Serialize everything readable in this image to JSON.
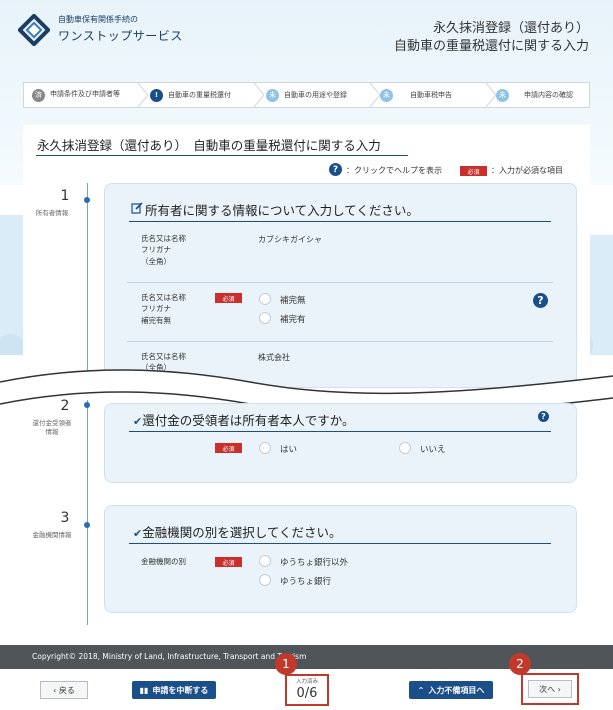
{
  "header": {
    "logo_line1": "自動車保有関係手続の",
    "logo_line2": "ワンストップサービス",
    "title_line1": "永久抹消登録（還付あり）",
    "title_line2": "自動車の重量税還付に関する入力"
  },
  "steps": [
    {
      "label": "申請条件及び申請者等",
      "icon": "済",
      "state": "done"
    },
    {
      "label": "自動車の重量税還付",
      "icon": "!",
      "state": "current"
    },
    {
      "label": "自動車の用途や登録",
      "icon": "未",
      "state": "todo"
    },
    {
      "label": "自動車税申告",
      "icon": "未",
      "state": "todo"
    },
    {
      "label": "申請内容の確認",
      "icon": "未",
      "state": "todo"
    }
  ],
  "page_title": "永久抹消登録（還付あり）　自動車の重量税還付に関する入力",
  "legend": {
    "help": "：クリックでヘルプを表示",
    "required": "必須",
    "required_text": "：入力が必須な項目"
  },
  "required_label": "必須",
  "sections": [
    {
      "num": "1",
      "label": "所有者情報",
      "title": "所有者に関する情報について入力してください。",
      "rows": [
        {
          "label": "氏名又は名称\nフリガナ\n（全角）",
          "value": "カブシキガイシャ"
        },
        {
          "label": "氏名又は名称\nフリガナ\n補完有無",
          "options": [
            "補完無",
            "補完有"
          ]
        },
        {
          "label": "氏名又は名称\n（全角）",
          "value": "株式会社"
        }
      ]
    },
    {
      "num": "2",
      "label": "還付金受領者情報",
      "title": "還付金の受領者は所有者本人ですか。",
      "options": [
        "はい",
        "いいえ"
      ]
    },
    {
      "num": "3",
      "label": "金融機関情報",
      "title": "金融機関の別を選択してください。",
      "row_label": "金融機関の別",
      "options": [
        "ゆうちょ銀行以外",
        "ゆうちょ銀行"
      ]
    }
  ],
  "footer": {
    "copyright": "Copyright© 2018, Ministry of Land, Infrastructure, Transport and Tourism"
  },
  "buttons": {
    "back": "‹ 戻る",
    "suspend": "申請を中断する",
    "unfinished": "入力不備項目へ",
    "next": "次へ ›"
  },
  "progress": {
    "label": "入力済み",
    "value": "0/6"
  },
  "annotations": [
    "1",
    "2"
  ],
  "colors": {
    "primary": "#1b4f8a",
    "required": "#c9302c",
    "annotation": "#c1392b",
    "footer": "#505559"
  }
}
